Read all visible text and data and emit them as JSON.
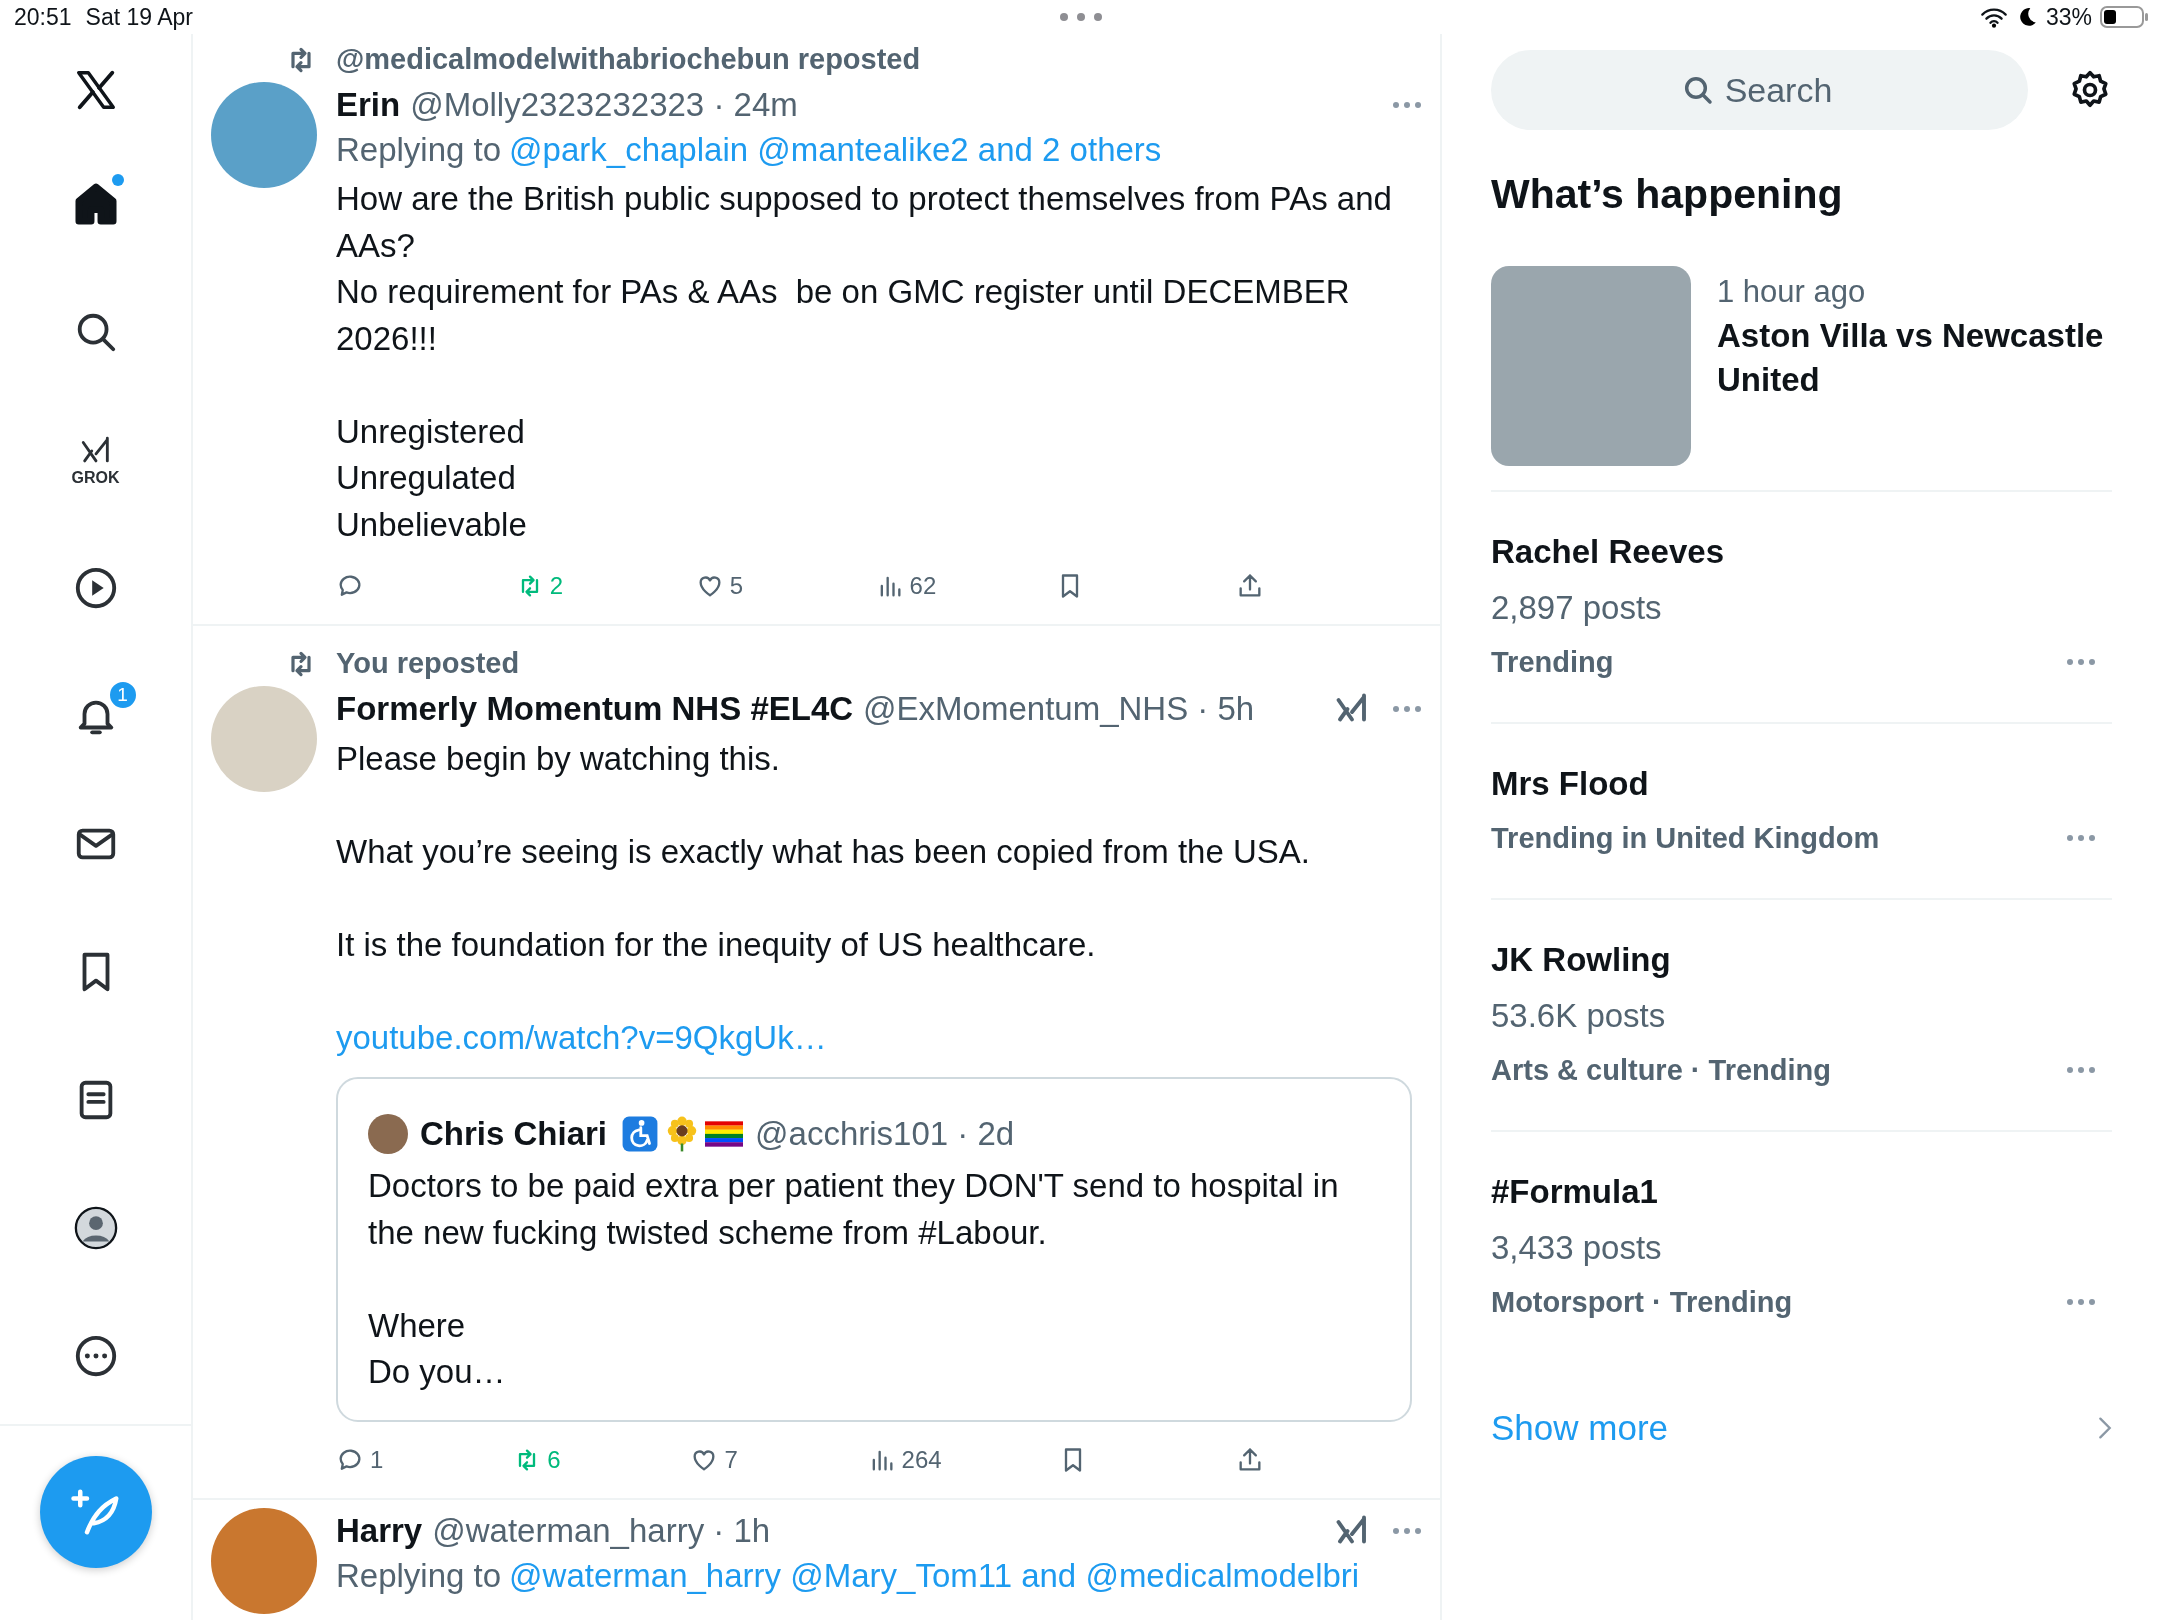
{
  "status_bar": {
    "time": "20:51",
    "date": "Sat 19 Apr",
    "battery": "33%"
  },
  "nav": {
    "items": [
      {
        "kind": "home",
        "selected": true,
        "dot": true
      },
      {
        "kind": "search",
        "selected": false,
        "dot": false
      },
      {
        "kind": "grok",
        "label": "GROK",
        "selected": false,
        "dot": false
      },
      {
        "kind": "video",
        "selected": false,
        "dot": false
      },
      {
        "kind": "notifications",
        "selected": false,
        "dot": false,
        "badge": "1"
      },
      {
        "kind": "messages",
        "selected": false,
        "dot": false
      },
      {
        "kind": "bookmarks",
        "selected": false,
        "dot": false
      },
      {
        "kind": "lists",
        "selected": false,
        "dot": false
      },
      {
        "kind": "profile",
        "selected": false,
        "dot": false
      },
      {
        "kind": "more",
        "selected": false,
        "dot": false
      }
    ]
  },
  "timeline": {
    "posts": [
      {
        "repost_by": "@medicalmodelwithabriochebun reposted",
        "name": "Erin",
        "meta": "@Molly2323232323 · 24m",
        "grok": false,
        "replying_label": "Replying to",
        "replying_to": "@park_chaplain @mantealike2 and 2 others",
        "body": "How are the British public supposed to protect themselves from PAs and AAs?\nNo requirement for PAs & AAs  be on GMC register until DECEMBER 2026!!!\n\nUnregistered\nUnregulated\nUnbelievable",
        "actions": [
          {
            "kind": "reply",
            "active": false
          },
          {
            "kind": "repost",
            "count": "2",
            "active": true
          },
          {
            "kind": "like",
            "count": "5",
            "active": false
          },
          {
            "kind": "views",
            "count": "62",
            "active": false
          },
          {
            "kind": "bookmark",
            "active": false
          },
          {
            "kind": "share",
            "active": false
          }
        ]
      },
      {
        "repost_by": "You reposted",
        "name": "Formerly Momentum NHS #EL4C",
        "meta": "@ExMomentum_NHS · 5h",
        "grok": true,
        "body": "Please begin by watching this.\n\nWhat you’re seeing is exactly what has been copied from the USA.\n\nIt is the foundation for the inequity of US healthcare.",
        "link": "youtube.com/watch?v=9QkgUk…",
        "quote": {
          "name": "Chris Chiari",
          "meta": "@acchris101 · 2d",
          "body": "Doctors to be paid extra per patient they DON'T send to hospital in the new fucking twisted scheme from #Labour.\n\nWhere\nDo you…"
        },
        "actions": [
          {
            "kind": "reply",
            "count": "1",
            "active": false
          },
          {
            "kind": "repost",
            "count": "6",
            "active": true
          },
          {
            "kind": "like",
            "count": "7",
            "active": false
          },
          {
            "kind": "views",
            "count": "264",
            "active": false
          },
          {
            "kind": "bookmark",
            "active": false
          },
          {
            "kind": "share",
            "active": false
          }
        ]
      },
      {
        "name": "Harry",
        "meta": "@waterman_harry · 1h",
        "grok": true,
        "replying_label": "Replying to",
        "replying_to": "@waterman_harry @Mary_Tom11 and @medicalmodelbri"
      }
    ]
  },
  "sidebar": {
    "search": {
      "placeholder": "Search"
    },
    "heading": "What’s happening",
    "trends": [
      {
        "kind": "event",
        "meta": "1 hour ago",
        "title": "Aston Villa vs Newcastle United"
      },
      {
        "kind": "trend",
        "title": "Rachel Reeves",
        "posts": "2,897 posts",
        "category": "Trending"
      },
      {
        "kind": "trend",
        "title": "Mrs Flood",
        "category": "Trending in United Kingdom"
      },
      {
        "kind": "trend",
        "title": "JK Rowling",
        "posts": "53.6K posts",
        "category": "Arts & culture · Trending"
      },
      {
        "kind": "trend",
        "title": "#Formula1",
        "posts": "3,433 posts",
        "category": "Motorsport · Trending"
      }
    ],
    "show_more": "Show more"
  }
}
